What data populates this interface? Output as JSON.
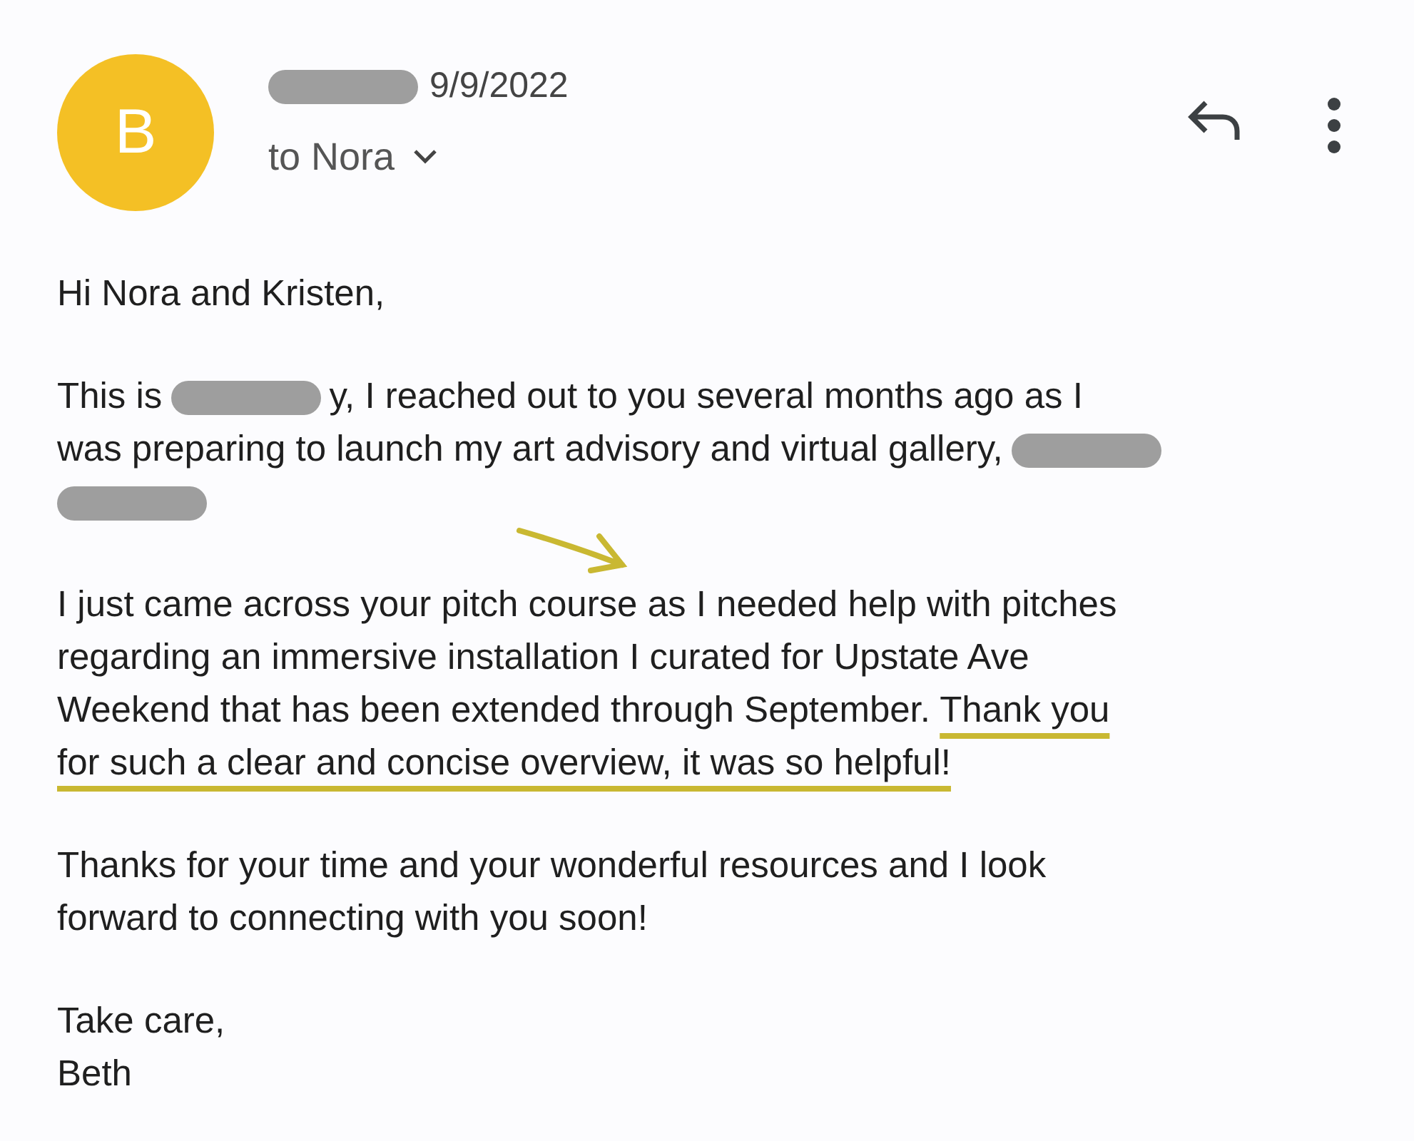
{
  "header": {
    "avatar_letter": "B",
    "sender_redacted": true,
    "date": "9/9/2022",
    "recipient": "to Nora"
  },
  "paragraphs": [
    {
      "lines": [
        [
          {
            "kind": "text",
            "text": "Hi Nora and Kristen,"
          }
        ]
      ]
    },
    {
      "lines": [
        [
          {
            "kind": "text",
            "text": "This is"
          },
          {
            "kind": "redaction"
          },
          {
            "kind": "text",
            "text": "y, I reached out to you several months ago as I"
          }
        ],
        [
          {
            "kind": "text",
            "text": "was preparing to launch my art advisory and virtual gallery,"
          },
          {
            "kind": "redaction"
          }
        ],
        [
          {
            "kind": "redaction"
          }
        ]
      ]
    },
    {
      "arrow": true,
      "lines": [
        [
          {
            "kind": "text",
            "text": "I just came across your pitch course as I needed help with pitches"
          }
        ],
        [
          {
            "kind": "text",
            "text": "regarding an immersive installation I curated for Upstate Ave"
          }
        ],
        [
          {
            "kind": "text",
            "text": "Weekend that has been extended through September. "
          },
          {
            "kind": "underlined",
            "text": "Thank you"
          }
        ],
        [
          {
            "kind": "underlined",
            "text": "for such a clear and concise overview, it was so helpful!"
          }
        ]
      ]
    },
    {
      "lines": [
        [
          {
            "kind": "text",
            "text": "Thanks for your time and your wonderful resources and I look"
          }
        ],
        [
          {
            "kind": "text",
            "text": "forward to connecting with you soon!"
          }
        ]
      ]
    },
    {
      "lines": [
        [
          {
            "kind": "text",
            "text": "Take care,"
          }
        ],
        [
          {
            "kind": "text",
            "text": "Beth"
          }
        ]
      ]
    }
  ]
}
